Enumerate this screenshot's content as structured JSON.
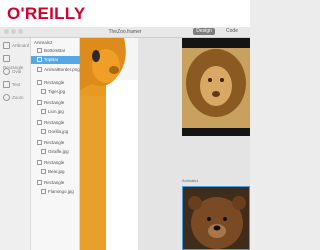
{
  "brand": {
    "logo_text": "O'REILLY"
  },
  "window": {
    "title": "TheZoo.framer"
  },
  "toolbar": {
    "design_label": "Design",
    "code_label": "Code"
  },
  "left_rail": {
    "items": [
      {
        "label": "Artboard",
        "icon": "artboard-icon"
      },
      {
        "label": "Rectangle",
        "icon": "rectangle-icon"
      },
      {
        "label": "Oval",
        "icon": "oval-icon"
      },
      {
        "label": "Text",
        "icon": "text-icon"
      },
      {
        "label": "Zoom",
        "icon": "zoom-icon"
      }
    ]
  },
  "layers": {
    "root": "Animals2",
    "items": [
      {
        "label": "BottomBar",
        "selected": false
      },
      {
        "label": "TopBar",
        "selected": true
      },
      {
        "label": "AnimalBorder.png",
        "selected": false
      },
      {
        "label": "Rectangle",
        "selected": false
      },
      {
        "label": "Tiger.jpg",
        "selected": false
      },
      {
        "label": "Rectangle",
        "selected": false
      },
      {
        "label": "Lion.jpg",
        "selected": false
      },
      {
        "label": "Rectangle",
        "selected": false
      },
      {
        "label": "Gorilla.jpg",
        "selected": false
      },
      {
        "label": "Rectangle",
        "selected": false
      },
      {
        "label": "Giraffe.jpg",
        "selected": false
      },
      {
        "label": "Rectangle",
        "selected": false
      },
      {
        "label": "Bear.jpg",
        "selected": false
      },
      {
        "label": "Rectangle",
        "selected": false
      },
      {
        "label": "Flamingo.jpg",
        "selected": false
      }
    ]
  },
  "canvas": {
    "artboard_label": "Animals1"
  },
  "colors": {
    "brand_red": "#d3002d",
    "selection_blue": "#55a8e8",
    "accent_orange": "#e9a12a"
  }
}
